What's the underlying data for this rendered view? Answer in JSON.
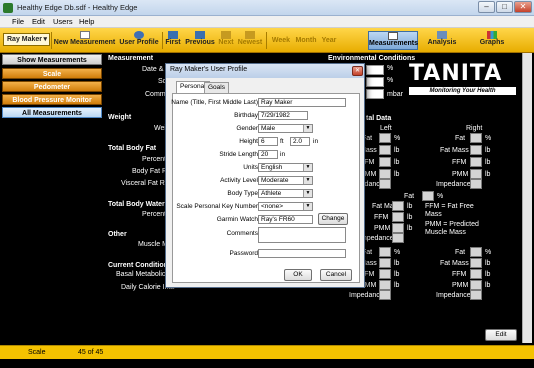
{
  "window": {
    "title": "Healthy Edge Db.sdf - Healthy Edge"
  },
  "menu": [
    "File",
    "Edit",
    "Users",
    "Help"
  ],
  "toolbar": {
    "user": "Ray Maker",
    "new_measurement": "New Measurement",
    "user_profile": "User Profile",
    "first": "First",
    "previous": "Previous",
    "next": "Next",
    "newest": "Newest",
    "week": "Week",
    "month": "Month",
    "year": "Year",
    "measurements": "Measurements",
    "analysis": "Analysis",
    "graphs": "Graphs"
  },
  "sidebar": {
    "items": [
      "Show Measurements",
      "Scale",
      "Pedometer",
      "Blood Pressure Monitor",
      "All Measurements"
    ]
  },
  "main": {
    "measurement": "Measurement",
    "date": "Date & T",
    "scale": "Sc",
    "comments": "Comme",
    "env": "Environmental Conditions",
    "pct1": "%",
    "pct2": "%",
    "mbar": "mbar",
    "weight": "Weight",
    "weight_sub": "Weig",
    "body_fat": "Total Body Fat",
    "percent": "Percent",
    "body_fat_ratio": "Body Fat Rat",
    "visceral": "Visceral Fat Rat",
    "body_water": "Total Body Water",
    "percent2": "Percent",
    "other": "Other",
    "muscle": "Muscle Ma",
    "current": "Current Condition",
    "bmr": "Basal Metabolic R",
    "daily": "Daily Calorie Inta",
    "tanita_brand": "TANITA",
    "tanita_tag": "Monitoring Your Health",
    "total_data": "tal Data",
    "left": "Left",
    "right": "Right",
    "seg_labels": [
      "Fat",
      "Fat Mass",
      "FFM",
      "PMM",
      "Impedance"
    ],
    "fat_lbl": "Fat",
    "fatmass_lbl": "Fat Mass",
    "ffm_lbl": "FFM",
    "pmm_lbl": "PMM",
    "imp_lbl": "Impedance",
    "pct": "%",
    "lb": "lb",
    "ffm_note": "FFM = Fat Free Mass",
    "pmm_note": "PMM = Predicted Muscle Mass",
    "edit": "Edit"
  },
  "dialog": {
    "title": "Ray Maker's User Profile",
    "tabs": [
      "Personal",
      "Goals"
    ],
    "name_label": "Name (Title, First Middle Last)",
    "name_value": "Ray Maker",
    "birthday_label": "Birthday",
    "birthday_value": "7/29/1982",
    "gender_label": "Gender",
    "gender_value": "Male",
    "height_label": "Height",
    "height_ft": "6",
    "ft": "ft",
    "height_in": "2.0",
    "in": "in",
    "stride_label": "Stride Length",
    "stride_value": "20",
    "stride_unit": "in",
    "units_label": "Units",
    "units_value": "English",
    "activity_label": "Activity Level",
    "activity_value": "Moderate",
    "bodytype_label": "Body Type",
    "bodytype_value": "Athlete",
    "scalekey_label": "Scale Personal Key Number",
    "scalekey_value": "<none>",
    "garmin_label": "Garmin Watch",
    "garmin_value": "Ray's FR60",
    "change": "Change",
    "comments_label": "Comments",
    "password_label": "Password",
    "ok": "OK",
    "cancel": "Cancel"
  },
  "status": {
    "mode": "Scale",
    "count": "45 of 45"
  }
}
